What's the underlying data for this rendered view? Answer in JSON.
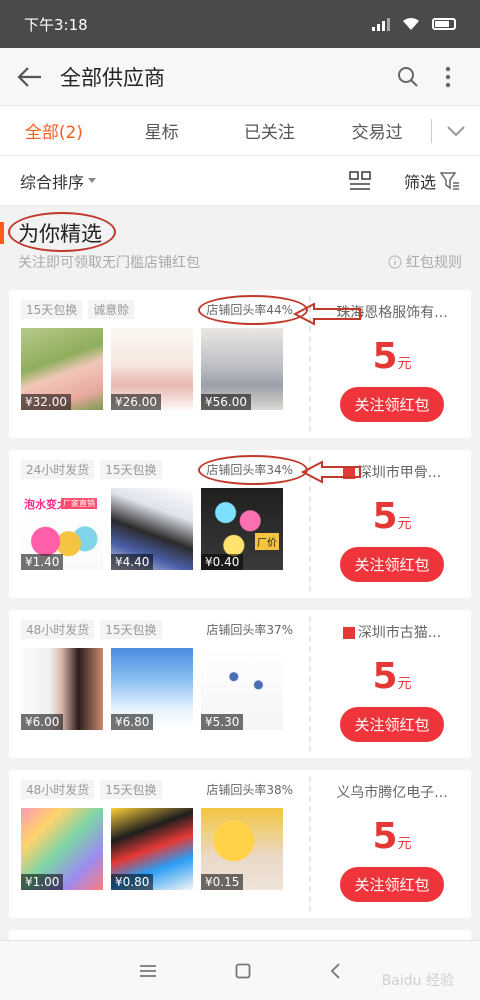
{
  "status": {
    "time": "下午3:18"
  },
  "header": {
    "title": "全部供应商"
  },
  "tabs": [
    {
      "label": "全部(2)",
      "active": true
    },
    {
      "label": "星标",
      "active": false
    },
    {
      "label": "已关注",
      "active": false
    },
    {
      "label": "交易过",
      "active": false
    }
  ],
  "sortbar": {
    "sort_label": "综合排序",
    "filter_label": "筛选"
  },
  "section": {
    "title": "为你精选",
    "subtitle": "关注即可领取无门槛店铺红包",
    "rule_label": "红包规则"
  },
  "cards": [
    {
      "tags": [
        "15天包换",
        "诚意赊"
      ],
      "repeat_rate": "店铺回头率44%",
      "shop": "珠海恩格服饰有...",
      "amount": "5",
      "unit": "元",
      "button": "关注领红包",
      "prices": [
        "¥32.00",
        "¥26.00",
        "¥56.00"
      ]
    },
    {
      "tags": [
        "24小时发货",
        "15天包换"
      ],
      "repeat_rate": "店铺回头率34%",
      "shop": "深圳市甲骨...",
      "amount": "5",
      "unit": "元",
      "button": "关注领红包",
      "prices": [
        "¥1.40",
        "¥4.40",
        "¥0.40"
      ],
      "product_texts": [
        "泡水变大",
        "厂家直销",
        "厂价"
      ]
    },
    {
      "tags": [
        "48小时发货",
        "15天包换"
      ],
      "repeat_rate": "店铺回头率37%",
      "shop": "深圳市古猫...",
      "amount": "5",
      "unit": "元",
      "button": "关注领红包",
      "prices": [
        "¥6.00",
        "¥6.80",
        "¥5.30"
      ]
    },
    {
      "tags": [
        "48小时发货",
        "15天包换"
      ],
      "repeat_rate": "店铺回头率38%",
      "shop": "义乌市腾亿电子...",
      "amount": "5",
      "unit": "元",
      "button": "关注领红包",
      "prices": [
        "¥1.00",
        "¥0.80",
        "¥0.15"
      ]
    }
  ],
  "watermark": "Baidu 经验",
  "colors": {
    "accent": "#ff5c1a",
    "red": "#f0343c",
    "annotation": "#c0392b"
  }
}
